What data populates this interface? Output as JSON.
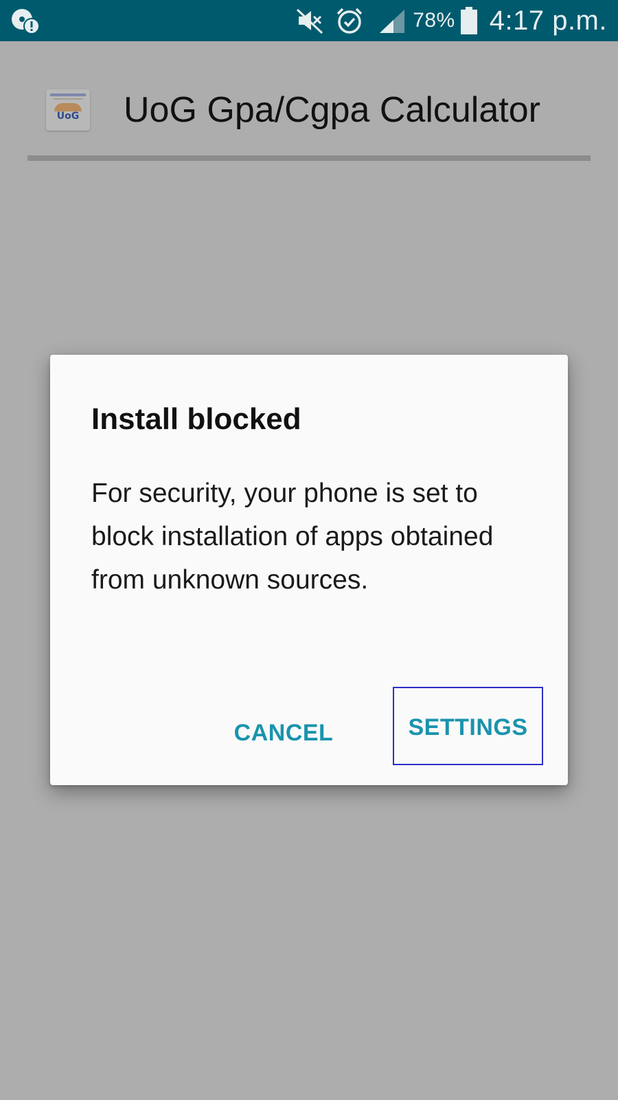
{
  "status_bar": {
    "left_icon": "data-usage-warning-icon",
    "icons": [
      "mute-icon",
      "alarm-icon",
      "signal-icon",
      "battery-icon"
    ],
    "battery_percent": "78%",
    "time": "4:17 p.m.",
    "background_color": "#005a6e"
  },
  "app": {
    "icon": "uog-app-icon",
    "icon_text": "UoG",
    "title": "UoG Gpa/Cgpa Calculator"
  },
  "dialog": {
    "title": "Install blocked",
    "message": "For security, your phone is set to block installation of apps obtained from unknown sources.",
    "buttons": {
      "cancel": "CANCEL",
      "settings": "SETTINGS"
    },
    "accent_color": "#1a93ad",
    "focus_outline_color": "#2e2ec8"
  },
  "scrim_color": "#adadad"
}
